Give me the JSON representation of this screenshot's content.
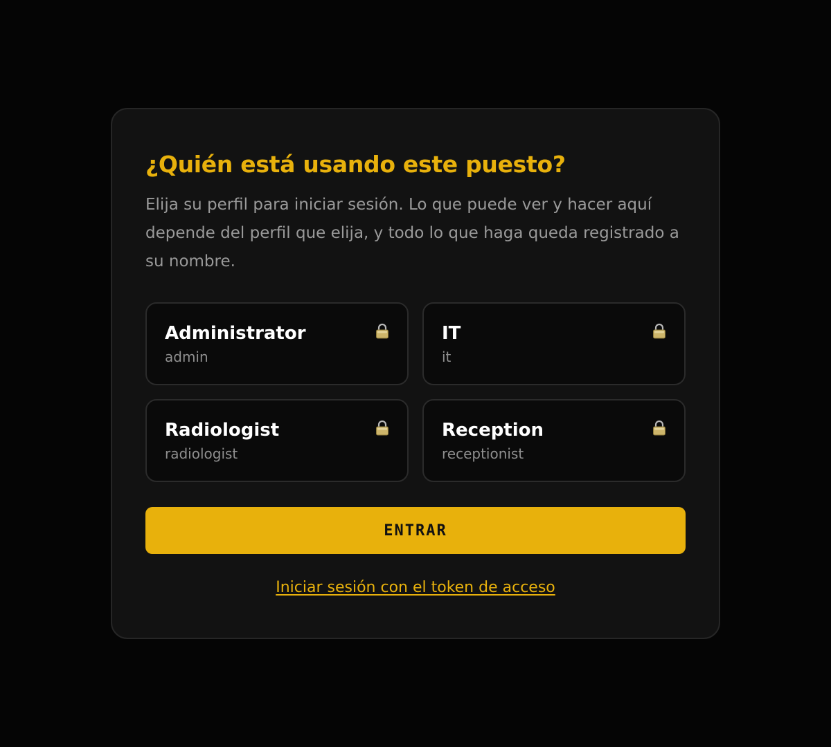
{
  "header": {
    "title": "¿Quién está usando este puesto?",
    "subtitle": "Elija su perfil para iniciar sesión. Lo que puede ver y hacer aquí depende del perfil que elija, y todo lo que haga queda registrado a su nombre."
  },
  "profiles": [
    {
      "name": "Administrator",
      "username": "admin",
      "icon": "lock-icon"
    },
    {
      "name": "IT",
      "username": "it",
      "icon": "lock-icon"
    },
    {
      "name": "Radiologist",
      "username": "radiologist",
      "icon": "lock-icon"
    },
    {
      "name": "Reception",
      "username": "receptionist",
      "icon": "lock-icon"
    }
  ],
  "actions": {
    "submit_label": "ENTRAR",
    "token_link": "Iniciar sesión con el token de acceso"
  },
  "colors": {
    "accent": "#E8B10C",
    "background": "#050505",
    "card": "#121212"
  }
}
